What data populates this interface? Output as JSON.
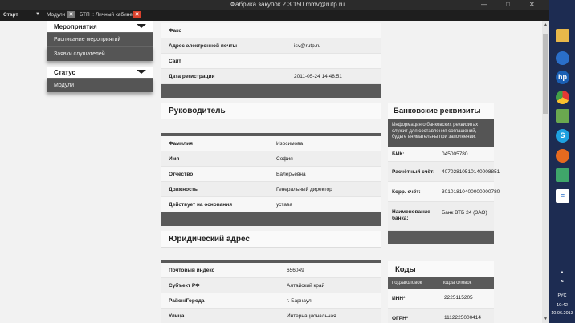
{
  "window": {
    "title": "Фабрика закупок 2.3.150 mmv@rutp.ru",
    "minimize": "—",
    "maximize": "□",
    "close": "✕"
  },
  "tabbar": {
    "start": "Старт",
    "tab1": "Модули",
    "tab2": "БТП :: Личный кабинет",
    "close_glyph": "✕",
    "caret_glyph": "▼"
  },
  "left_panel": {
    "events_title": "Мероприятия",
    "events_items": [
      "Расписание мероприятий",
      "Заявки слушателей"
    ],
    "status_title": "Статус",
    "status_items": [
      "Модули"
    ]
  },
  "contacts": [
    {
      "label": "Факс",
      "value": ""
    },
    {
      "label": "Адрес электронной почты",
      "value": "isv@rutp.ru"
    },
    {
      "label": "Сайт",
      "value": ""
    },
    {
      "label": "Дата регистрации",
      "value": "2011-05-24 14:48:51"
    }
  ],
  "director": {
    "title": "Руководитель",
    "rows": [
      {
        "label": "Фамилия",
        "value": "Изосимова"
      },
      {
        "label": "Имя",
        "value": "София"
      },
      {
        "label": "Отчество",
        "value": "Валерьевна"
      },
      {
        "label": "Должность",
        "value": "Генеральный директор"
      },
      {
        "label": "Действует на основания",
        "value": "устава"
      }
    ]
  },
  "legal_address": {
    "title": "Юридический адрес",
    "rows": [
      {
        "label": "Почтовый индекс",
        "value": "656049"
      },
      {
        "label": "Субъект РФ",
        "value": "Алтайский край"
      },
      {
        "label": "Район/Города",
        "value": "г. Барнаул,"
      },
      {
        "label": "Улица",
        "value": "Интернациональная"
      }
    ]
  },
  "bank": {
    "title": "Банковские реквизиты",
    "notice": "Информация о банковских реквизитах служит для составления соглашений, будьте внимательны при заполнении.",
    "rows": [
      {
        "label": "БИК:",
        "value": "045005780"
      },
      {
        "label": "Расчётный счёт:",
        "value": "40702810510140008851"
      },
      {
        "label": "Корр. счёт:",
        "value": "30101810400000000780"
      },
      {
        "label": "Наименование банка:",
        "value": "Банк ВТБ 24 (ЗАО)"
      }
    ]
  },
  "codes": {
    "title": "Коды",
    "col1": "подзаголовок",
    "col2": "подзаголовок",
    "rows": [
      {
        "label": "ИНН*",
        "value": "2225115205"
      },
      {
        "label": "ОГРН*",
        "value": "1112225000414"
      }
    ]
  },
  "charms_bar": {
    "icons": [
      "folder-icon",
      "globe-icon",
      "hp-icon",
      "chrome-icon",
      "network-icon",
      "skype-icon",
      "firefox-icon",
      "app-icon",
      "document-icon"
    ],
    "hp_label": "hp",
    "skype_label": "S",
    "document_label": "≡",
    "chevron": "▲",
    "flag": "⚑",
    "lang": "РУС",
    "time": "10:42",
    "date": "10.06.2013"
  },
  "colors": {
    "charms_bg": "#1d2c52",
    "dark_bar": "#5a5a5a",
    "notice_bg": "#555555"
  }
}
